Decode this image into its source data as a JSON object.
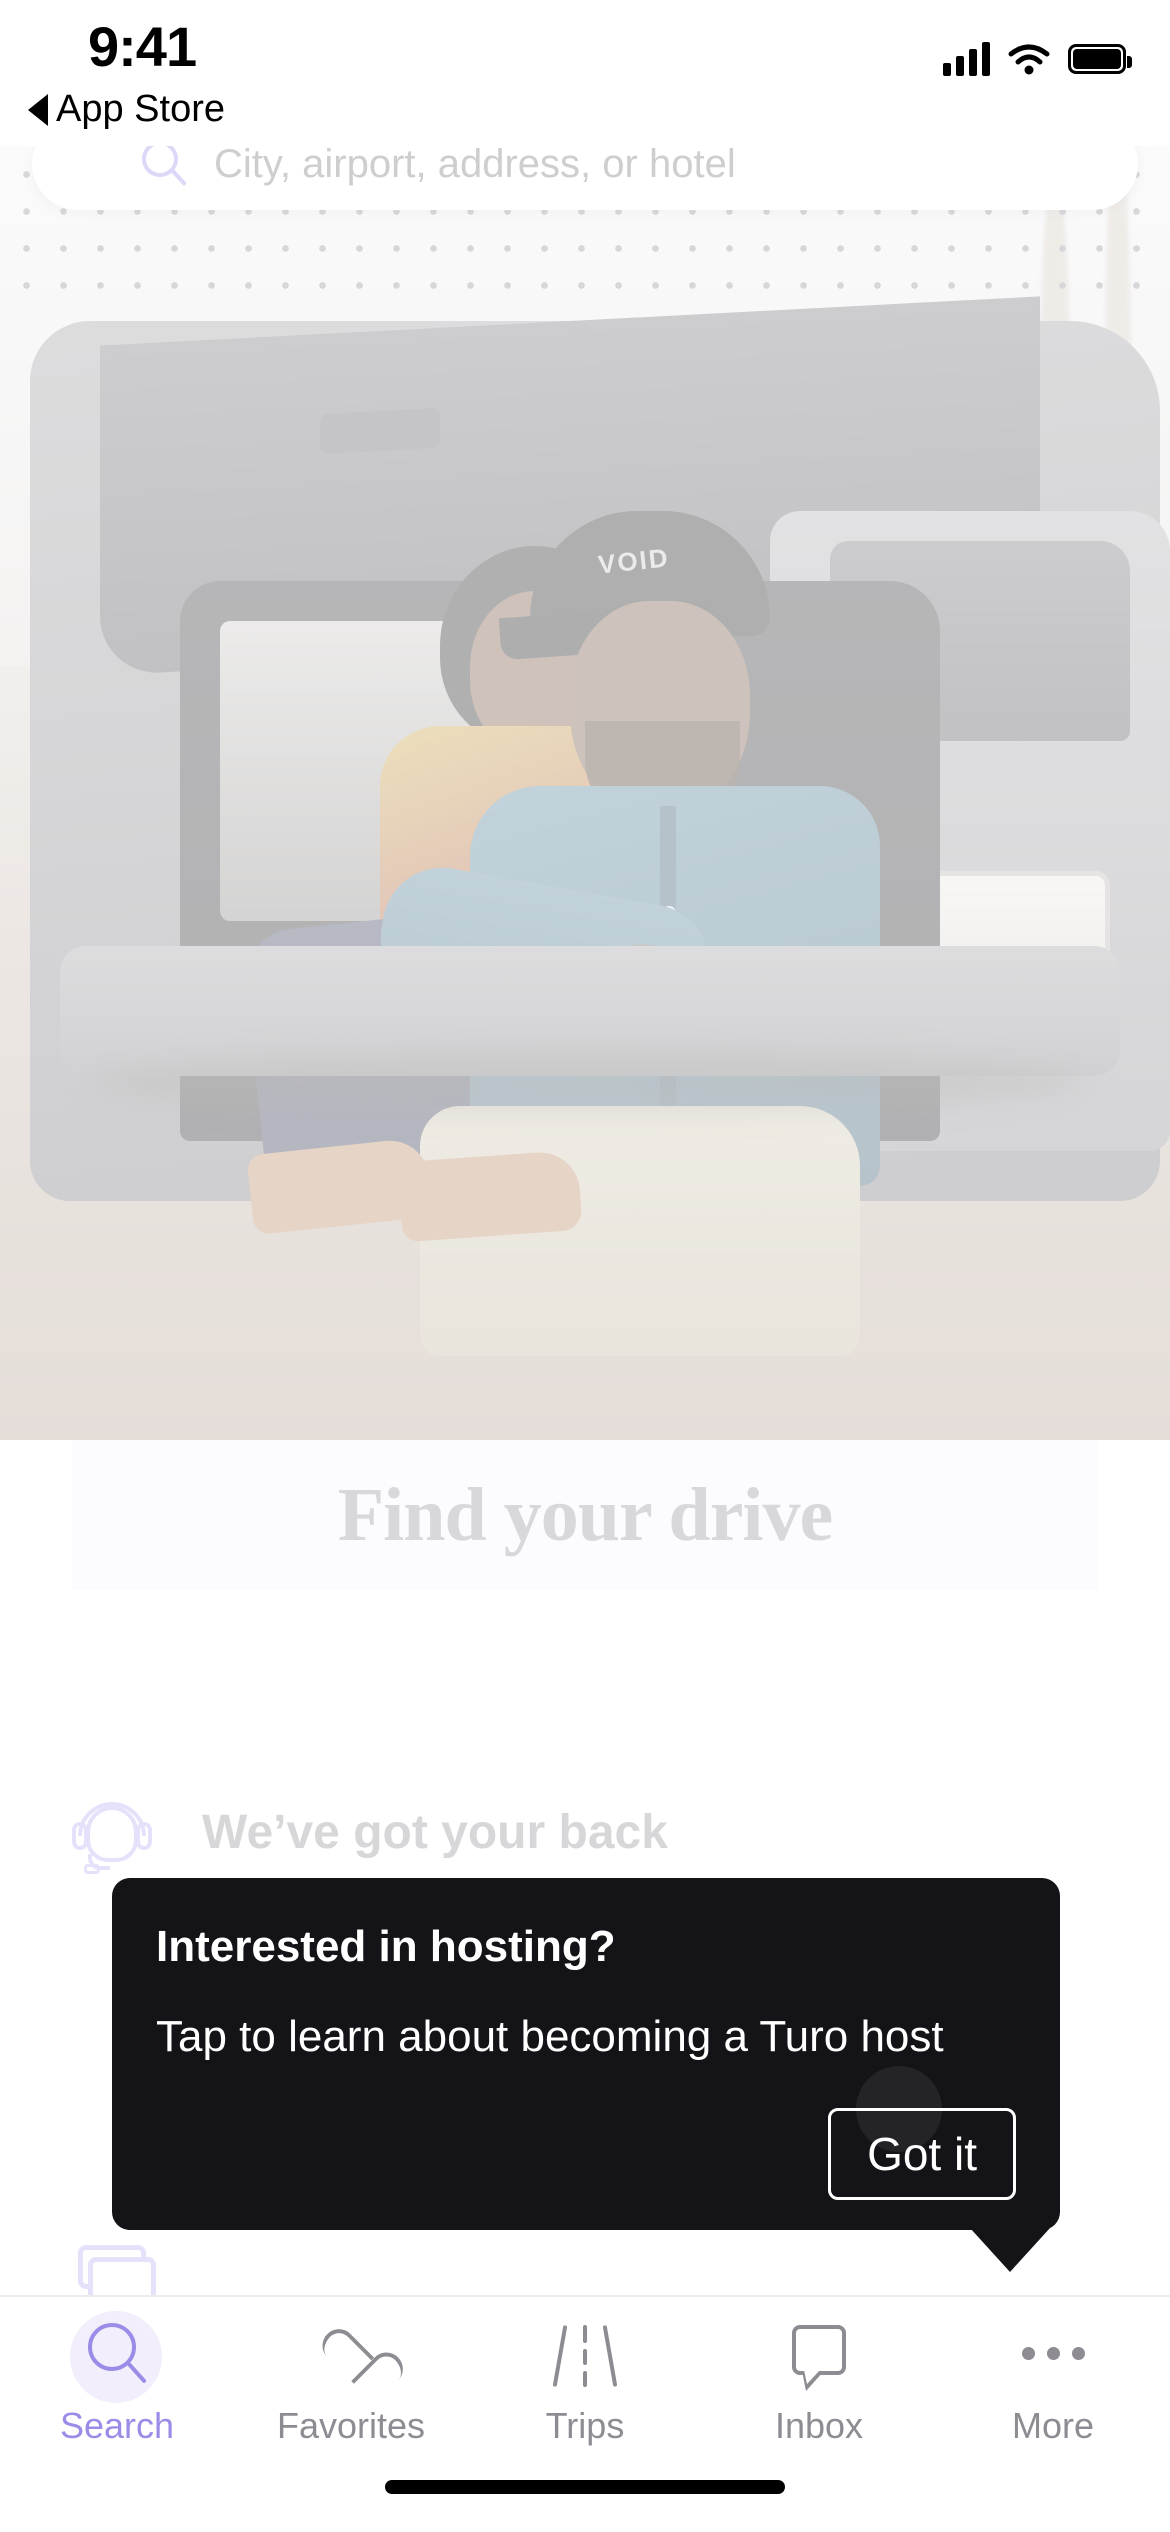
{
  "status_bar": {
    "time": "9:41",
    "back_label": "App Store",
    "back_icon": "back-triangle-icon",
    "signal_icon": "cellular-signal-icon",
    "wifi_icon": "wifi-icon",
    "battery_icon": "battery-full-icon"
  },
  "search": {
    "placeholder": "City, airport, address, or hotel",
    "icon": "search-icon",
    "value": ""
  },
  "hero": {
    "alt": "Couple sitting in the open trunk of an SUV",
    "pattern": "polka-dot-overlay"
  },
  "band": {
    "title": "Find your drive"
  },
  "rows": [
    {
      "label": "We’ve got your back",
      "icon": "support-agent-icon"
    },
    {
      "label": "",
      "icon": "card-stack-icon"
    }
  ],
  "tooltip": {
    "title": "Interested in hosting?",
    "body": "Tap to learn about becoming a Turo host",
    "dismiss_label": "Got it",
    "background": "#141418",
    "pointer": "arrow-down"
  },
  "tabbar": {
    "active": "Search",
    "accent_color": "#9b8ce8",
    "inactive_color": "#8e8c92",
    "items": [
      {
        "label": "Search",
        "icon": "search-icon"
      },
      {
        "label": "Favorites",
        "icon": "heart-icon"
      },
      {
        "label": "Trips",
        "icon": "road-icon"
      },
      {
        "label": "Inbox",
        "icon": "speech-bubble-icon"
      },
      {
        "label": "More",
        "icon": "ellipsis-icon"
      }
    ]
  },
  "home_indicator": "home-indicator"
}
